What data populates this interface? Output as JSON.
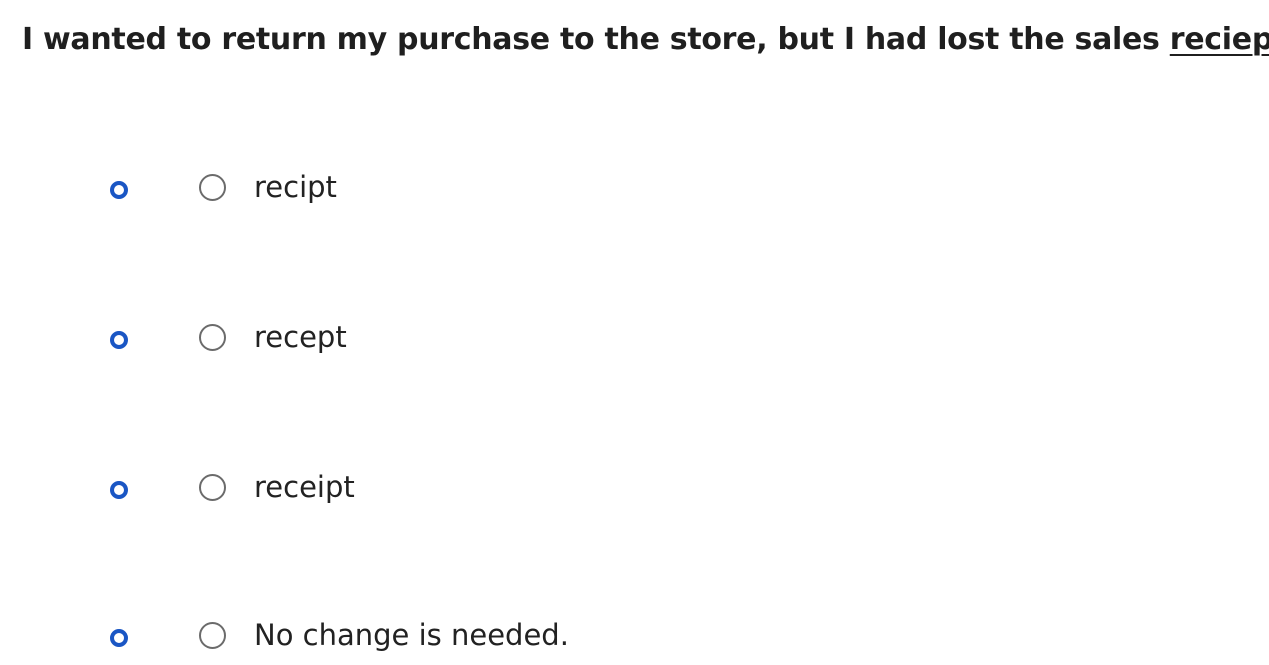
{
  "question": {
    "before": "I wanted to return my purchase to the store, but I had lost the sales ",
    "underlined_word": "reciept",
    "after": "."
  },
  "options": [
    {
      "label": "recipt"
    },
    {
      "label": "recept"
    },
    {
      "label": "receipt"
    },
    {
      "label": "No change is needed."
    }
  ],
  "colors": {
    "marker": "#1a56c4",
    "radio_border": "#6b6b6b",
    "text": "#1f1f1f"
  }
}
